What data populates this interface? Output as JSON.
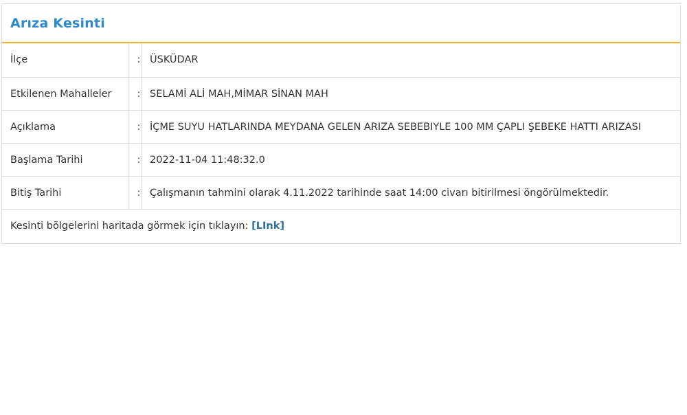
{
  "panel": {
    "title": "Arıza Kesinti"
  },
  "rows": [
    {
      "label": "İlçe",
      "sep": ":",
      "value": "ÜSKÜDAR"
    },
    {
      "label": "Etkilenen Mahalleler",
      "sep": ":",
      "value": "SELAMİ ALİ MAH,MİMAR SİNAN MAH"
    },
    {
      "label": "Açıklama",
      "sep": ":",
      "value": "İÇME SUYU HATLARINDA MEYDANA GELEN ARIZA SEBEBIYLE 100 MM ÇAPLI ŞEBEKE HATTI ARIZASI"
    },
    {
      "label": "Başlama Tarihi",
      "sep": ":",
      "value": "2022-11-04 11:48:32.0"
    },
    {
      "label": "Bitiş Tarihi",
      "sep": ":",
      "value": "Çalışmanın tahmini olarak 4.11.2022 tarihinde saat 14:00 civarı bitirilmesi öngörülmektedir."
    }
  ],
  "footer": {
    "text": "Kesinti bölgelerini haritada görmek için tıklayın: ",
    "link_label": "[LInk]"
  },
  "colors": {
    "title": "#2e8bc9",
    "header_underline": "#f0b42b",
    "link": "#2a6ea6"
  }
}
